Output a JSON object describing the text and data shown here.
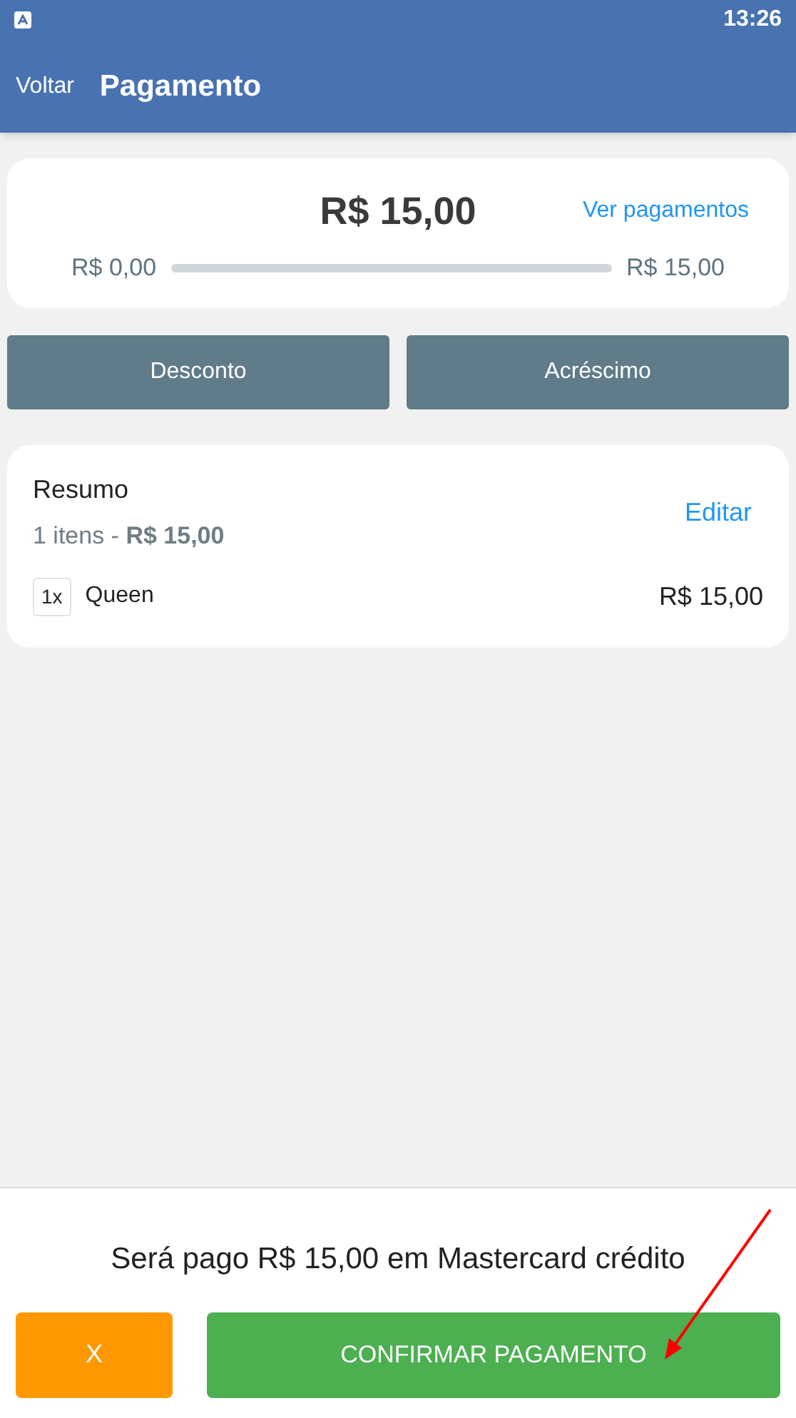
{
  "status_bar": {
    "time": "13:26"
  },
  "header": {
    "back": "Voltar",
    "title": "Pagamento"
  },
  "payment": {
    "total": "R$ 15,00",
    "link": "Ver pagamentos",
    "min": "R$ 0,00",
    "max": "R$ 15,00",
    "level": 0
  },
  "adjustments": [
    "Desconto",
    "Acréscimo"
  ],
  "summary": {
    "title": "Resumo",
    "subtitle": "1 itens - **R$ 15,00**",
    "edit": "Editar",
    "items": [
      {
        "qty": "1x",
        "name": "Queen",
        "price": "R$ 15,00"
      }
    ]
  },
  "footer": {
    "message": "Será pago R$ 15,00 em Mastercard crédito",
    "cancel": "X",
    "confirm": "CONFIRMAR PAGAMENTO"
  }
}
